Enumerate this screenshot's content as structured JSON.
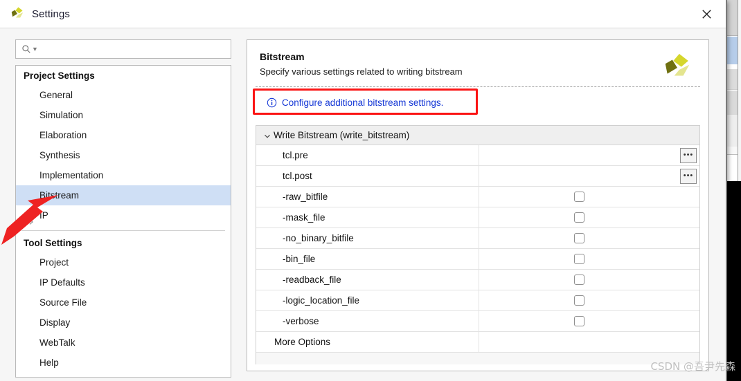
{
  "window": {
    "title": "Settings",
    "logo_icon": "vivado-logo-icon",
    "close_icon": "close-icon"
  },
  "search": {
    "placeholder": "",
    "value": "",
    "icon": "search-icon",
    "dropdown_icon": "chevron-down-icon"
  },
  "sidebar": {
    "groups": [
      {
        "title": "Project Settings",
        "items": [
          {
            "label": "General",
            "selected": false,
            "expandable": false
          },
          {
            "label": "Simulation",
            "selected": false,
            "expandable": false
          },
          {
            "label": "Elaboration",
            "selected": false,
            "expandable": false
          },
          {
            "label": "Synthesis",
            "selected": false,
            "expandable": false
          },
          {
            "label": "Implementation",
            "selected": false,
            "expandable": false
          },
          {
            "label": "Bitstream",
            "selected": true,
            "expandable": false
          },
          {
            "label": "IP",
            "selected": false,
            "expandable": true
          }
        ]
      },
      {
        "title": "Tool Settings",
        "items": [
          {
            "label": "Project",
            "selected": false,
            "expandable": false
          },
          {
            "label": "IP Defaults",
            "selected": false,
            "expandable": false
          },
          {
            "label": "Source File",
            "selected": false,
            "expandable": false
          },
          {
            "label": "Display",
            "selected": false,
            "expandable": false
          },
          {
            "label": "WebTalk",
            "selected": false,
            "expandable": false
          },
          {
            "label": "Help",
            "selected": false,
            "expandable": false
          }
        ]
      }
    ]
  },
  "panel": {
    "title": "Bitstream",
    "subtitle": "Specify various settings related to writing bitstream",
    "logo_icon": "vivado-logo-icon",
    "info": {
      "icon": "info-circle-icon",
      "link_text": "Configure additional bitstream settings.",
      "link_color": "#1437d6",
      "highlight_color": "#fb1414"
    }
  },
  "settings_table": {
    "section": {
      "label": "Write Bitstream (write_bitstream)",
      "collapse_icon": "chevron-down-icon",
      "expanded": true
    },
    "rows": [
      {
        "name": "tcl.pre",
        "control": "text-with-browse",
        "value": "",
        "browse_label": "•••",
        "checked": false,
        "indent": true
      },
      {
        "name": "tcl.post",
        "control": "text-with-browse",
        "value": "",
        "browse_label": "•••",
        "checked": false,
        "indent": true
      },
      {
        "name": "-raw_bitfile",
        "control": "checkbox",
        "value": "",
        "checked": false,
        "indent": true
      },
      {
        "name": "-mask_file",
        "control": "checkbox",
        "value": "",
        "checked": false,
        "indent": true
      },
      {
        "name": "-no_binary_bitfile",
        "control": "checkbox",
        "value": "",
        "checked": false,
        "indent": true
      },
      {
        "name": "-bin_file",
        "control": "checkbox",
        "value": "",
        "checked": false,
        "indent": true
      },
      {
        "name": "-readback_file",
        "control": "checkbox",
        "value": "",
        "checked": false,
        "indent": true
      },
      {
        "name": "-logic_location_file",
        "control": "checkbox",
        "value": "",
        "checked": false,
        "indent": true
      },
      {
        "name": "-verbose",
        "control": "checkbox",
        "value": "",
        "checked": false,
        "indent": true
      },
      {
        "name": "More Options",
        "control": "none",
        "value": "",
        "checked": false,
        "indent": false
      }
    ]
  },
  "annotations": {
    "arrow": {
      "name": "red-arrow-annotation",
      "color": "#ee2222",
      "points_to": "Bitstream"
    },
    "box": {
      "name": "red-highlight-box",
      "color": "#fb1414",
      "surrounds": "Configure additional bitstream settings."
    }
  },
  "watermark": {
    "text": "CSDN @吾尹先森"
  }
}
